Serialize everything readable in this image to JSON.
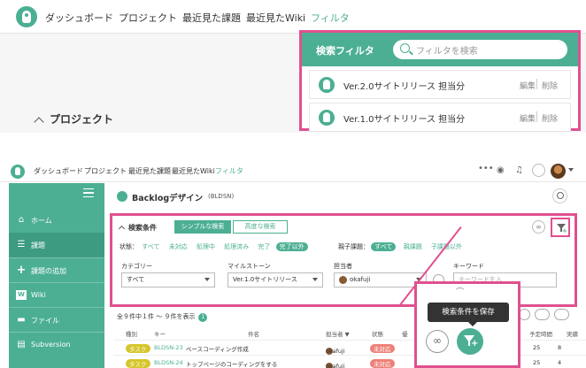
{
  "top": {
    "nav": [
      "ダッシュボード",
      "プロジェクト",
      "最近見た課題",
      "最近見たWiki",
      "フィルタ"
    ],
    "project_heading": "プロジェクト",
    "filter_panel": {
      "title": "検索フィルタ",
      "search_placeholder": "フィルタを検索",
      "items": [
        {
          "label": "Ver.2.0サイトリリース 担当分",
          "edit": "編集",
          "delete": "削除"
        },
        {
          "label": "Ver.1.0サイトリリース 担当分",
          "edit": "編集",
          "delete": "削除"
        }
      ]
    }
  },
  "bottom": {
    "nav": [
      "ダッシュボード",
      "プロジェクト",
      "最近見た課題",
      "最近見たWiki",
      "フィルタ"
    ],
    "nav_icons": [
      "more-icon",
      "eye-icon",
      "bell-icon",
      "search-icon",
      "avatar"
    ],
    "sidebar": [
      {
        "label": "ホーム",
        "icon": "home-icon"
      },
      {
        "label": "課題",
        "icon": "list-icon"
      },
      {
        "label": "課題の追加",
        "icon": "plus-icon"
      },
      {
        "label": "Wiki",
        "icon": "wiki-icon"
      },
      {
        "label": "ファイル",
        "icon": "folder-icon"
      },
      {
        "label": "Subversion",
        "icon": "svn-icon"
      }
    ],
    "project": {
      "name": "Backlogデザイン",
      "key": "(BLDSN)"
    },
    "conditions": {
      "title": "検索条件",
      "tab_simple": "シンプルな検索",
      "tab_advanced": "高度な検索",
      "status_label": "状態：",
      "statuses": [
        "すべて",
        "未対応",
        "処理中",
        "処理済み",
        "完了",
        "完了以外"
      ],
      "status_selected": "完了以外",
      "parent_label": "親子課題：",
      "parents": [
        "すべて",
        "親課題",
        "子課題以外"
      ],
      "parent_selected": "すべて",
      "category_label": "カテゴリー",
      "category_value": "すべて",
      "milestone_label": "マイルストーン",
      "milestone_value": "Ver.1.0サイトリリース",
      "assignee_label": "担当者",
      "assignee_value": "okafuji",
      "keyword_label": "キーワード",
      "keyword_placeholder": "キーワードを入"
    },
    "count_text": "全９件中１件 〜 ９件を表示",
    "count_badge": "1",
    "table": {
      "headers": [
        "種別",
        "キー",
        "件名",
        "担当者 ▼",
        "状態",
        "優",
        "予定時間",
        "実績"
      ],
      "rows": [
        {
          "type": "タスク",
          "key": "BLDSN-23",
          "subject": "ベースコーディング作成",
          "assignee": "okafuji",
          "status": "未対応",
          "c1": "25",
          "c2": "8"
        },
        {
          "type": "タスク",
          "key": "BLDSN-24",
          "subject": "トップページのコーディングをする",
          "assignee": "okafuji",
          "status": "未対応",
          "c1": "25",
          "c2": "4"
        }
      ]
    },
    "popup": {
      "tooltip": "検索条件を保存"
    }
  },
  "colors": {
    "brand": "#4caf93",
    "highlight": "#e0508f"
  }
}
